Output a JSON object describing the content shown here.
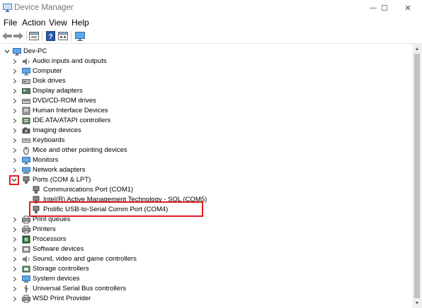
{
  "window": {
    "title": "Device Manager",
    "minimize_glyph": "—",
    "maximize_glyph": "☐",
    "close_glyph": "✕"
  },
  "menu": [
    "File",
    "Action",
    "View",
    "Help"
  ],
  "toolbar_icons": [
    "back-arrow-icon",
    "forward-arrow-icon",
    "properties-sheet-icon",
    "help-icon",
    "action-sheet-icon",
    "monitor-icon"
  ],
  "tree": {
    "root": "Dev-PC",
    "categories": [
      {
        "label": "Audio inputs and outputs",
        "icon": "speaker-icon"
      },
      {
        "label": "Computer",
        "icon": "computer-icon"
      },
      {
        "label": "Disk drives",
        "icon": "disk-drive-icon"
      },
      {
        "label": "Display adapters",
        "icon": "display-adapter-icon"
      },
      {
        "label": "DVD/CD-ROM drives",
        "icon": "dvd-drive-icon"
      },
      {
        "label": "Human Interface Devices",
        "icon": "hid-icon"
      },
      {
        "label": "IDE ATA/ATAPI controllers",
        "icon": "ide-controller-icon"
      },
      {
        "label": "Imaging devices",
        "icon": "camera-icon"
      },
      {
        "label": "Keyboards",
        "icon": "keyboard-icon"
      },
      {
        "label": "Mice and other pointing devices",
        "icon": "mouse-icon"
      },
      {
        "label": "Monitors",
        "icon": "monitor-icon"
      },
      {
        "label": "Network adapters",
        "icon": "network-adapter-icon"
      },
      {
        "label": "Ports (COM & LPT)",
        "icon": "port-icon",
        "expanded": true,
        "children": [
          "Communications Port (COM1)",
          "Intel(R) Active Management Technology - SOL (COM5)",
          "Prolific USB-to-Serial Comm Port (COM4)"
        ]
      },
      {
        "label": "Print queues",
        "icon": "printer-icon"
      },
      {
        "label": "Printers",
        "icon": "printer-icon"
      },
      {
        "label": "Processors",
        "icon": "processor-icon"
      },
      {
        "label": "Software devices",
        "icon": "software-device-icon"
      },
      {
        "label": "Sound, video and game controllers",
        "icon": "speaker-icon"
      },
      {
        "label": "Storage controllers",
        "icon": "storage-controller-icon"
      },
      {
        "label": "System devices",
        "icon": "system-device-icon"
      },
      {
        "label": "Universal Serial Bus controllers",
        "icon": "usb-icon"
      },
      {
        "label": "WSD Print Provider",
        "icon": "printer-icon"
      }
    ]
  },
  "highlight_color": "#e31b23",
  "accent_color": "#0078d7"
}
